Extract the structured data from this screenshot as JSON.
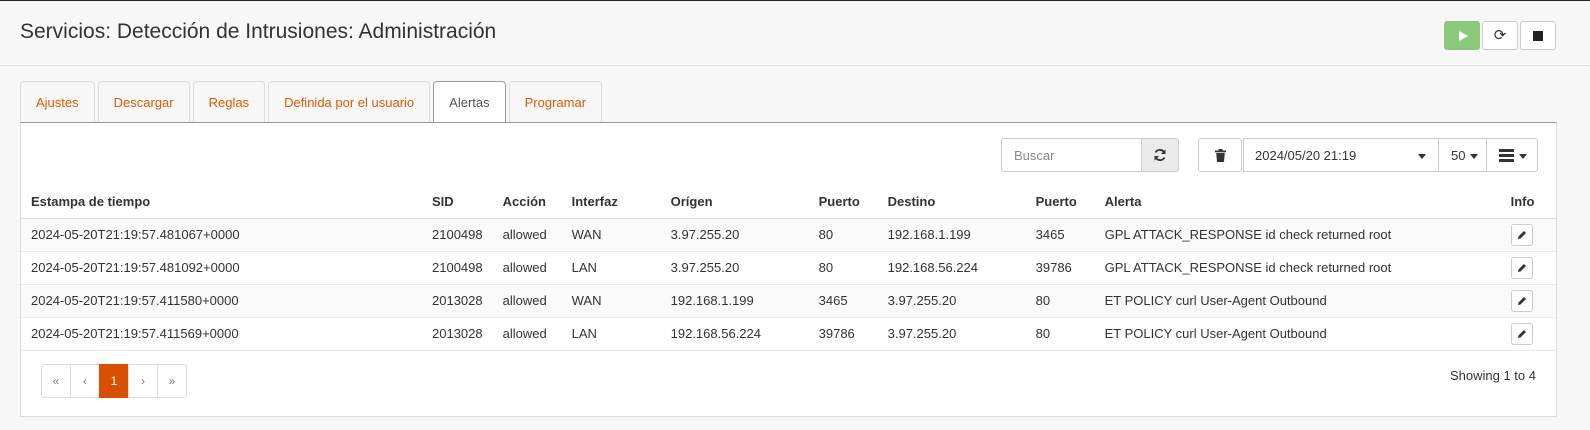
{
  "header": {
    "title": "Servicios: Detección de Intrusiones: Administración"
  },
  "service_buttons": {
    "start_icon": "play-icon",
    "restart_icon": "reload-icon",
    "stop_icon": "stop-icon",
    "start_color": "#8bc97a"
  },
  "tabs": [
    {
      "label": "Ajustes",
      "active": false
    },
    {
      "label": "Descargar",
      "active": false
    },
    {
      "label": "Reglas",
      "active": false
    },
    {
      "label": "Definida por el usuario",
      "active": false
    },
    {
      "label": "Alertas",
      "active": true
    },
    {
      "label": "Programar",
      "active": false
    }
  ],
  "toolbar": {
    "search_placeholder": "Buscar",
    "date_value": "2024/05/20 21:19",
    "page_size": "50"
  },
  "table": {
    "columns": [
      "Estampa de tiempo",
      "SID",
      "Acción",
      "Interfaz",
      "Orígen",
      "Puerto",
      "Destino",
      "Puerto",
      "Alerta",
      "Info"
    ],
    "rows": [
      [
        "2024-05-20T21:19:57.481067+0000",
        "2100498",
        "allowed",
        "WAN",
        "3.97.255.20",
        "80",
        "192.168.1.199",
        "3465",
        "GPL ATTACK_RESPONSE id check returned root"
      ],
      [
        "2024-05-20T21:19:57.481092+0000",
        "2100498",
        "allowed",
        "LAN",
        "3.97.255.20",
        "80",
        "192.168.56.224",
        "39786",
        "GPL ATTACK_RESPONSE id check returned root"
      ],
      [
        "2024-05-20T21:19:57.411580+0000",
        "2013028",
        "allowed",
        "WAN",
        "192.168.1.199",
        "3465",
        "3.97.255.20",
        "80",
        "ET POLICY curl User-Agent Outbound"
      ],
      [
        "2024-05-20T21:19:57.411569+0000",
        "2013028",
        "allowed",
        "LAN",
        "192.168.56.224",
        "39786",
        "3.97.255.20",
        "80",
        "ET POLICY curl User-Agent Outbound"
      ]
    ]
  },
  "pagination": {
    "first": "«",
    "prev": "‹",
    "current": "1",
    "next": "›",
    "last": "»"
  },
  "footer": {
    "showing": "Showing 1 to 4"
  },
  "colors": {
    "accent": "#e05a00",
    "active_page": "#d94f00"
  }
}
